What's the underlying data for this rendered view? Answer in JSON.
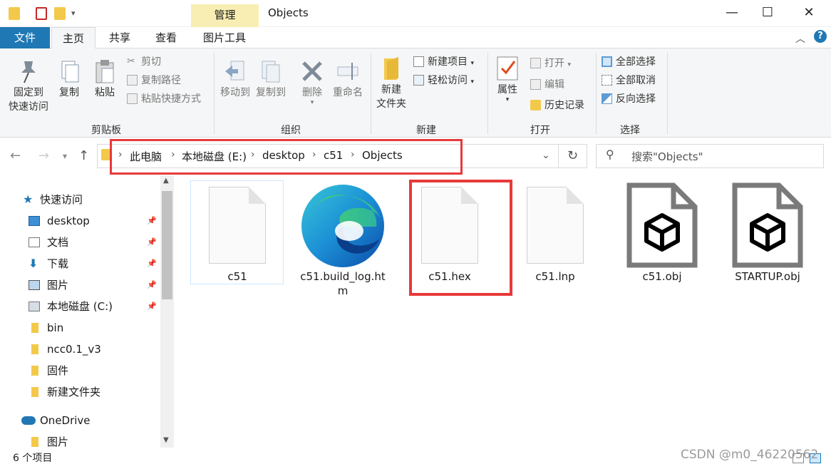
{
  "window": {
    "title": "Objects",
    "context_tab": "管理",
    "minimize": "—",
    "maximize": "☐",
    "close": "✕"
  },
  "ribbon_tabs": [
    "文件",
    "主页",
    "共享",
    "查看",
    "图片工具"
  ],
  "ribbon": {
    "clipboard": {
      "pin": "固定到\n快速访问",
      "copy": "复制",
      "paste": "粘贴",
      "cut": "剪切",
      "copy_path": "复制路径",
      "paste_shortcut": "粘贴快捷方式",
      "label": "剪贴板"
    },
    "organize": {
      "move_to": "移动到",
      "copy_to": "复制到",
      "delete": "删除",
      "rename": "重命名",
      "label": "组织"
    },
    "new": {
      "new_folder": "新建\n文件夹",
      "new_item": "新建项目",
      "easy_access": "轻松访问",
      "label": "新建"
    },
    "open": {
      "properties": "属性",
      "open": "打开",
      "edit": "编辑",
      "history": "历史记录",
      "label": "打开"
    },
    "select": {
      "select_all": "全部选择",
      "select_none": "全部取消",
      "invert": "反向选择",
      "label": "选择"
    }
  },
  "address": {
    "crumbs": [
      "此电脑",
      "本地磁盘 (E:)",
      "desktop",
      "c51",
      "Objects"
    ],
    "search_placeholder": "搜索\"Objects\""
  },
  "sidebar": {
    "quick_access": "快速访问",
    "items": [
      "desktop",
      "文档",
      "下载",
      "图片",
      "本地磁盘 (C:)",
      "bin",
      "ncc0.1_v3",
      "固件",
      "新建文件夹"
    ],
    "onedrive": "OneDrive",
    "onedrive_items": [
      "图片"
    ]
  },
  "files": [
    {
      "name": "c51",
      "type": "blank"
    },
    {
      "name": "c51.build_log.htm",
      "type": "edge"
    },
    {
      "name": "c51.hex",
      "type": "blank"
    },
    {
      "name": "c51.lnp",
      "type": "blank"
    },
    {
      "name": "c51.obj",
      "type": "obj"
    },
    {
      "name": "STARTUP.obj",
      "type": "obj"
    }
  ],
  "status": {
    "count": "6 个项目"
  },
  "watermark": "CSDN @m0_46220562",
  "colors": {
    "accent": "#1f78b4",
    "highlight": "#e8393a",
    "context_tab": "#f8eeb3"
  }
}
